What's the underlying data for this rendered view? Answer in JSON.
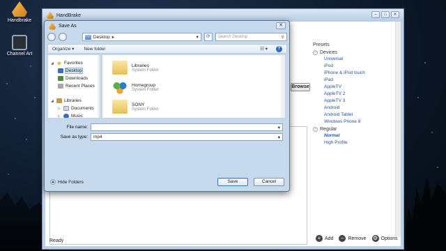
{
  "desktop": {
    "icons": [
      {
        "label": "Handbrake"
      },
      {
        "label": "Channel Art"
      }
    ]
  },
  "main_window": {
    "title": "HandBrake",
    "browse_label": "Browse",
    "status": "Ready",
    "presets": {
      "title": "Presets",
      "devices_label": "Devices",
      "devices": [
        "Universal",
        "iPod",
        "iPhone & iPod touch",
        "iPad",
        "AppleTV",
        "AppleTV 2",
        "AppleTV 3",
        "Android",
        "Android Tablet",
        "Windows Phone 8"
      ],
      "regular_label": "Regular",
      "regular": [
        "Normal",
        "High Profile"
      ],
      "selected": "Normal"
    },
    "actions": {
      "add": "Add",
      "remove": "Remove",
      "options": "Options"
    }
  },
  "save_dialog": {
    "title": "Save As",
    "address": "Desktop",
    "search_placeholder": "Search Desktop",
    "toolbar": {
      "organize": "Organize ▾",
      "new_folder": "New folder"
    },
    "nav": {
      "favorites": "Favorites",
      "desktop": "Desktop",
      "downloads": "Downloads",
      "recent_places": "Recent Places",
      "libraries": "Libraries",
      "documents": "Documents",
      "music": "Music"
    },
    "files": [
      {
        "name": "Libraries",
        "type": "System Folder"
      },
      {
        "name": "Homegroup",
        "type": "System Folder"
      },
      {
        "name": "SONY",
        "type": "System Folder"
      }
    ],
    "fields": {
      "file_name_label": "File name:",
      "file_name_value": "",
      "save_as_type_label": "Save as type:",
      "save_as_type_value": "mp4"
    },
    "hide_folders": "Hide Folders",
    "save": "Save",
    "cancel": "Cancel"
  }
}
